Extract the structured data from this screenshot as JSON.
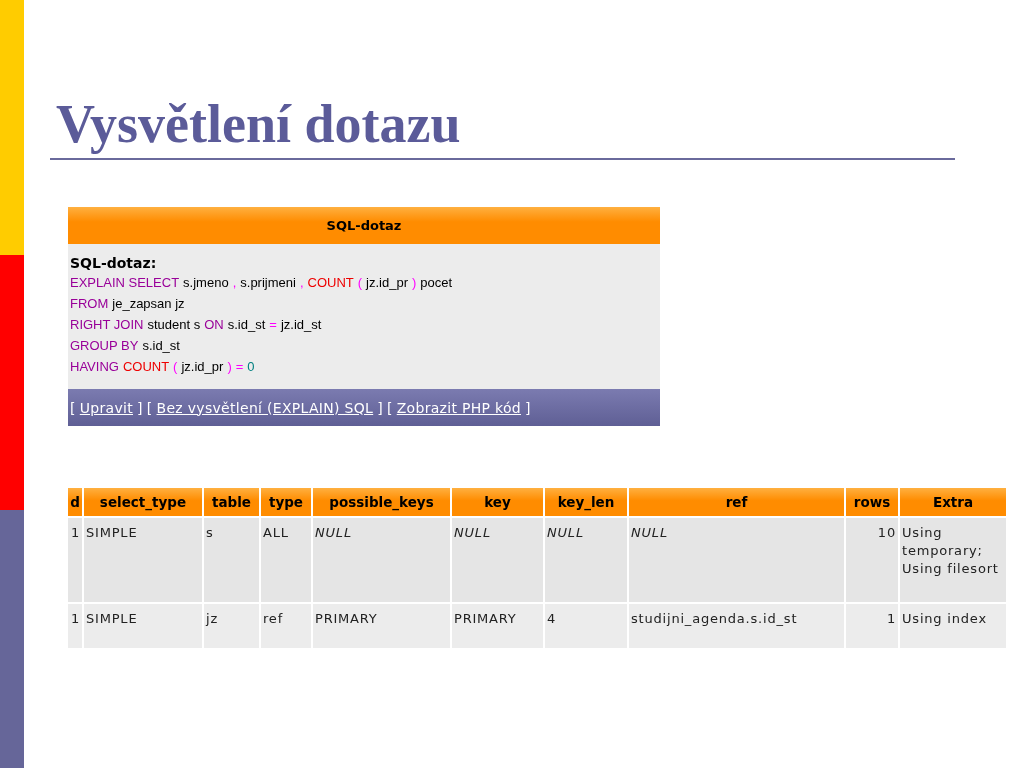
{
  "slide": {
    "title": "Vysvětlení dotazu"
  },
  "sql_box": {
    "header": "SQL-dotaz",
    "label": "SQL-dotaz:",
    "lines": [
      [
        {
          "text": "EXPLAIN SELECT",
          "kind": "keyword"
        },
        {
          "text": "s.jmeno",
          "kind": "ident"
        },
        {
          "text": ",",
          "kind": "punct"
        },
        {
          "text": "s.prijmeni",
          "kind": "ident"
        },
        {
          "text": ",",
          "kind": "punct"
        },
        {
          "text": "COUNT",
          "kind": "function"
        },
        {
          "text": "(",
          "kind": "punct"
        },
        {
          "text": "jz.id_pr",
          "kind": "ident"
        },
        {
          "text": ")",
          "kind": "punct"
        },
        {
          "text": "pocet",
          "kind": "ident"
        }
      ],
      [
        {
          "text": "FROM",
          "kind": "keyword"
        },
        {
          "text": "je_zapsan jz",
          "kind": "ident"
        }
      ],
      [
        {
          "text": "RIGHT JOIN",
          "kind": "keyword"
        },
        {
          "text": "student s",
          "kind": "ident"
        },
        {
          "text": "ON",
          "kind": "keyword"
        },
        {
          "text": "s.id_st",
          "kind": "ident"
        },
        {
          "text": "=",
          "kind": "punct"
        },
        {
          "text": "jz.id_st",
          "kind": "ident"
        }
      ],
      [
        {
          "text": "GROUP BY",
          "kind": "keyword"
        },
        {
          "text": "s.id_st",
          "kind": "ident"
        }
      ],
      [
        {
          "text": "HAVING",
          "kind": "keyword"
        },
        {
          "text": "COUNT",
          "kind": "function"
        },
        {
          "text": "(",
          "kind": "punct"
        },
        {
          "text": "jz.id_pr",
          "kind": "ident"
        },
        {
          "text": ")",
          "kind": "punct"
        },
        {
          "text": "=",
          "kind": "punct"
        },
        {
          "text": "0",
          "kind": "number"
        }
      ]
    ],
    "links": [
      {
        "open": "[",
        "label": "Upravit",
        "close": "]"
      },
      {
        "open": "[",
        "label": "Bez vysvětlení (EXPLAIN) SQL",
        "close": "]"
      },
      {
        "open": "[",
        "label": "Zobrazit PHP kód",
        "close": "]"
      }
    ]
  },
  "explain_table": {
    "columns": [
      "d",
      "select_type",
      "table",
      "type",
      "possible_keys",
      "key",
      "key_len",
      "ref",
      "rows",
      "Extra"
    ],
    "rows": [
      [
        {
          "text": "1",
          "kind": "number"
        },
        {
          "text": "SIMPLE",
          "kind": "value"
        },
        {
          "text": "s",
          "kind": "value"
        },
        {
          "text": "ALL",
          "kind": "value"
        },
        {
          "text": "NULL",
          "kind": "null"
        },
        {
          "text": "NULL",
          "kind": "null"
        },
        {
          "text": "NULL",
          "kind": "null"
        },
        {
          "text": "NULL",
          "kind": "null"
        },
        {
          "text": "10",
          "kind": "number"
        },
        {
          "text": "Using temporary; Using filesort",
          "kind": "value"
        }
      ],
      [
        {
          "text": "1",
          "kind": "number"
        },
        {
          "text": "SIMPLE",
          "kind": "value"
        },
        {
          "text": "jz",
          "kind": "value"
        },
        {
          "text": "ref",
          "kind": "value"
        },
        {
          "text": "PRIMARY",
          "kind": "value"
        },
        {
          "text": "PRIMARY",
          "kind": "value"
        },
        {
          "text": "4",
          "kind": "value"
        },
        {
          "text": "studijni_agenda.s.id_st",
          "kind": "value"
        },
        {
          "text": "1",
          "kind": "number"
        },
        {
          "text": "Using index",
          "kind": "value"
        }
      ]
    ]
  }
}
